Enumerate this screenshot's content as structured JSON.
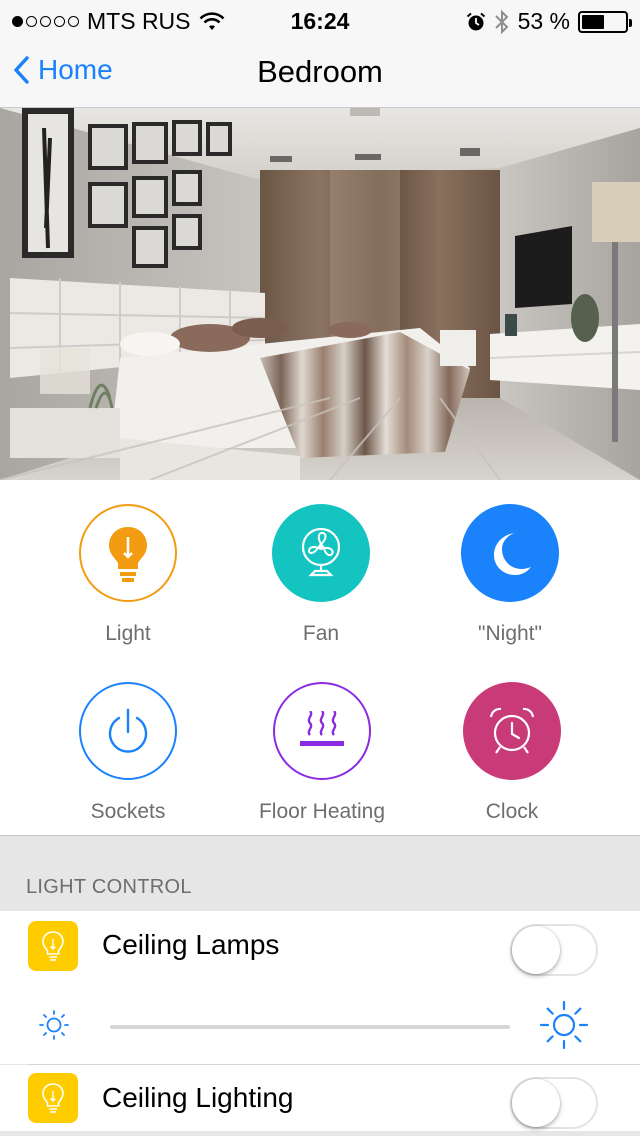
{
  "status_bar": {
    "signal_dots_filled": 1,
    "signal_dots_total": 5,
    "carrier": "MTS RUS",
    "time": "16:24",
    "battery_text": "53 %",
    "battery_level": 0.53,
    "icons": [
      "wifi-icon",
      "alarm-icon",
      "bluetooth-icon",
      "battery-icon"
    ]
  },
  "nav": {
    "back_label": "Home",
    "title": "Bedroom"
  },
  "devices": [
    {
      "label": "Light",
      "icon": "light-bulb-icon",
      "color": "#f39c12",
      "style": "outline"
    },
    {
      "label": "Fan",
      "icon": "fan-icon",
      "color": "#13c4c1",
      "style": "filled"
    },
    {
      "label": "\"Night\"",
      "icon": "moon-icon",
      "color": "#1a82fb",
      "style": "filled"
    },
    {
      "label": "Sockets",
      "icon": "power-icon",
      "color": "#1a82fb",
      "style": "outline"
    },
    {
      "label": "Floor Heating",
      "icon": "floor-heating-icon",
      "color": "#8a2be2",
      "style": "outline"
    },
    {
      "label": "Clock",
      "icon": "alarm-clock-icon",
      "color": "#c93a78",
      "style": "filled"
    }
  ],
  "light_control": {
    "header": "LIGHT CONTROL",
    "rows": [
      {
        "label": "Ceiling Lamps",
        "on": false,
        "brightness": 0
      },
      {
        "label": "Ceiling Lighting",
        "on": false
      }
    ]
  },
  "colors": {
    "accent": "#1a82fb",
    "bulb_tile": "#ffcc00"
  }
}
